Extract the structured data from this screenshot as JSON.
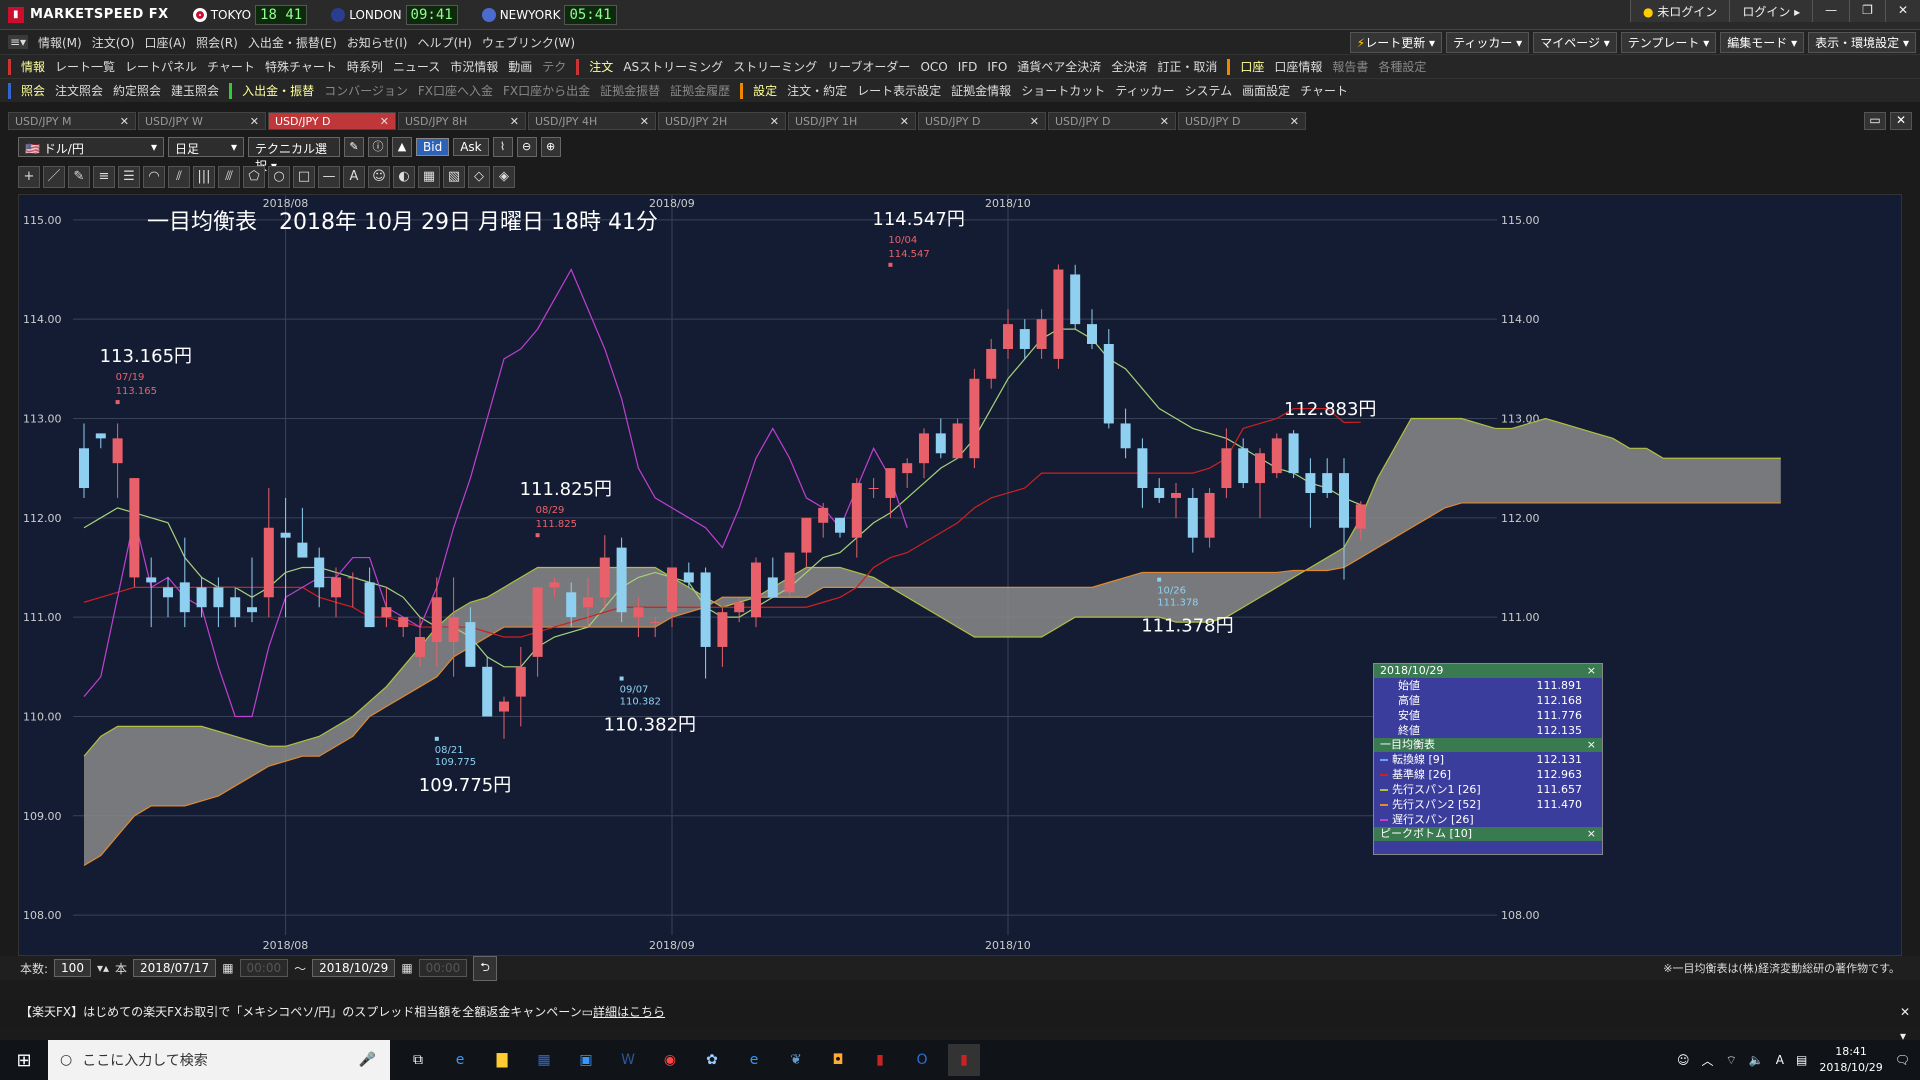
{
  "app": {
    "name": "MARKETSPEED FX"
  },
  "clocks": [
    {
      "label": "TOKYO",
      "time": "18 41",
      "color": "#c8102e"
    },
    {
      "label": "LONDON",
      "time": "09:41",
      "color": "#3a5bbf"
    },
    {
      "label": "NEWYORK",
      "time": "05:41",
      "color": "#4b6bcf"
    }
  ],
  "top_right": [
    "未ログイン",
    "ログイン"
  ],
  "menu": [
    "情報(M)",
    "注文(O)",
    "口座(A)",
    "照会(R)",
    "入出金・振替(E)",
    "お知らせ(I)",
    "ヘルプ(H)",
    "ウェブリンク(W)"
  ],
  "menu_right": [
    "レート更新",
    "ティッカー",
    "マイページ",
    "テンプレート",
    "編集モード",
    "表示・環境設定"
  ],
  "toolbar1": [
    "情報",
    "レート一覧",
    "レートパネル",
    "チャート",
    "特殊チャート",
    "時系列",
    "ニュース",
    "市況情報",
    "動画",
    "テク",
    "注文",
    "ASストリーミング",
    "ストリーミング",
    "リーブオーダー",
    "OCO",
    "IFD",
    "IFO",
    "通貨ペア全決済",
    "全決済",
    "訂正・取消",
    "口座",
    "口座情報",
    "報告書",
    "各種設定"
  ],
  "toolbar2": [
    "照会",
    "注文照会",
    "約定照会",
    "建玉照会",
    "入出金・振替",
    "コンバージョン",
    "FX口座へ入金",
    "FX口座から出金",
    "証拠金振替",
    "証拠金履歴",
    "設定",
    "注文・約定",
    "レート表示設定",
    "証拠金情報",
    "ショートカット",
    "ティッカー",
    "システム",
    "画面設定",
    "チャート"
  ],
  "tabs": [
    "USD/JPY M",
    "USD/JPY W",
    "USD/JPY D",
    "USD/JPY 8H",
    "USD/JPY 4H",
    "USD/JPY 2H",
    "USD/JPY 1H",
    "USD/JPY D",
    "USD/JPY D",
    "USD/JPY D"
  ],
  "active_tab": 2,
  "controls": {
    "pair": "ドル/円",
    "period": "日足",
    "tech": "テクニカル選択",
    "bid": "Bid",
    "ask": "Ask"
  },
  "draw_tools": [
    "+",
    "／",
    "✎",
    "≡",
    "☰",
    "◠",
    "⫽",
    "|||",
    "⫻",
    "⬠",
    "○",
    "□",
    "—",
    "A",
    "☺",
    "◐",
    "▦",
    "▧",
    "◇",
    "◈"
  ],
  "bottom": {
    "count_label": "本数:",
    "count": "100",
    "unit": "本",
    "from": "2018/07/17",
    "to": "2018/10/29",
    "time1": "00:00",
    "time2": "00:00",
    "note": "※一目均衡表は(株)経済変動総研の著作物です。"
  },
  "news": {
    "text": "【楽天FX】はじめての楽天FXお取引で「メキシコペソ/円」のスプレッド相当額を全額返金キャンペーン",
    "link": "詳細はこちら"
  },
  "taskbar": {
    "search": "ここに入力して検索",
    "time": "18:41",
    "date": "2018/10/29"
  },
  "info_panel": {
    "date": "2018/10/29",
    "ohlc": [
      [
        "始値",
        "111.891"
      ],
      [
        "高値",
        "112.168"
      ],
      [
        "安値",
        "111.776"
      ],
      [
        "終値",
        "112.135"
      ]
    ],
    "ichimoku_title": "一目均衡表",
    "lines": [
      [
        "転換線 [9]",
        "112.131",
        "#6fa0ff"
      ],
      [
        "基準線 [26]",
        "112.963",
        "#d02020"
      ],
      [
        "先行スパン1 [26]",
        "111.657",
        "#b0c040"
      ],
      [
        "先行スパン2 [52]",
        "111.470",
        "#e08a30"
      ],
      [
        "遅行スパン [26]",
        "",
        "#c040d0"
      ]
    ],
    "peak": "ピークボトム [10]"
  },
  "chart_data": {
    "type": "candlestick",
    "title": "一目均衡表　2018年 10月 29日 月曜日 18時 41分",
    "ylim": [
      107.8,
      115.25
    ],
    "yticks": [
      "108.00",
      "109.00",
      "110.00",
      "111.00",
      "112.00",
      "113.00",
      "114.00",
      "115.00"
    ],
    "xticks": [
      "2018/08",
      "2018/09",
      "2018/10"
    ],
    "annotations": [
      {
        "date": "07/19",
        "price": "113.165",
        "label": "113.165円",
        "type": "peak"
      },
      {
        "date": "08/21",
        "price": "109.775",
        "label": "109.775円",
        "type": "bottom"
      },
      {
        "date": "08/29",
        "price": "111.825",
        "label": "111.825円",
        "type": "peak"
      },
      {
        "date": "09/07",
        "price": "110.382",
        "label": "110.382円",
        "type": "bottom"
      },
      {
        "date": "10/04",
        "price": "114.547",
        "label": "114.547円",
        "type": "peak"
      },
      {
        "date": "10/26",
        "price": "111.378",
        "label": "111.378円",
        "type": "bottom"
      }
    ],
    "extra_label": "112.883円",
    "candles": [
      [
        112.7,
        112.95,
        112.2,
        112.3
      ],
      [
        112.85,
        112.85,
        112.7,
        112.8
      ],
      [
        112.55,
        112.95,
        112.2,
        112.8
      ],
      [
        111.4,
        112.4,
        111.3,
        112.4
      ],
      [
        111.4,
        111.6,
        110.9,
        111.35
      ],
      [
        111.3,
        111.4,
        111.0,
        111.2
      ],
      [
        111.35,
        111.8,
        110.9,
        111.05
      ],
      [
        111.3,
        111.4,
        111.0,
        111.1
      ],
      [
        111.3,
        111.4,
        110.9,
        111.1
      ],
      [
        111.2,
        111.3,
        110.9,
        111.0
      ],
      [
        111.1,
        111.6,
        110.95,
        111.05
      ],
      [
        111.2,
        112.3,
        111.0,
        111.9
      ],
      [
        111.85,
        112.2,
        111.0,
        111.8
      ],
      [
        111.75,
        112.1,
        111.6,
        111.6
      ],
      [
        111.6,
        111.7,
        111.1,
        111.3
      ],
      [
        111.2,
        111.5,
        111.0,
        111.4
      ],
      [
        111.4,
        111.45,
        111.1,
        111.4
      ],
      [
        111.35,
        111.5,
        110.9,
        110.9
      ],
      [
        111.0,
        111.3,
        110.9,
        111.1
      ],
      [
        110.9,
        111.0,
        110.8,
        111.0
      ],
      [
        110.6,
        111.0,
        110.5,
        110.8
      ],
      [
        110.75,
        111.4,
        110.5,
        111.2
      ],
      [
        110.75,
        111.4,
        110.4,
        111.0
      ],
      [
        110.95,
        111.1,
        110.5,
        110.5
      ],
      [
        110.5,
        110.6,
        110.0,
        110.0
      ],
      [
        110.05,
        110.2,
        109.775,
        110.15
      ],
      [
        110.2,
        110.7,
        109.9,
        110.5
      ],
      [
        110.6,
        111.3,
        110.4,
        111.3
      ],
      [
        111.3,
        111.4,
        111.2,
        111.35
      ],
      [
        111.25,
        111.35,
        110.9,
        111.0
      ],
      [
        111.1,
        111.4,
        110.9,
        111.2
      ],
      [
        111.2,
        111.825,
        111.1,
        111.6
      ],
      [
        111.7,
        111.8,
        110.95,
        111.05
      ],
      [
        111.0,
        111.2,
        110.8,
        111.1
      ],
      [
        110.95,
        111.0,
        110.8,
        110.95
      ],
      [
        111.05,
        111.5,
        110.9,
        111.5
      ],
      [
        111.45,
        111.55,
        111.3,
        111.35
      ],
      [
        111.45,
        111.5,
        110.382,
        110.7
      ],
      [
        110.7,
        111.1,
        110.5,
        111.05
      ],
      [
        111.05,
        111.2,
        110.95,
        111.15
      ],
      [
        111.0,
        111.6,
        110.9,
        111.55
      ],
      [
        111.4,
        111.6,
        111.2,
        111.2
      ],
      [
        111.25,
        111.65,
        111.2,
        111.65
      ],
      [
        111.65,
        112.0,
        111.5,
        112.0
      ],
      [
        111.95,
        112.15,
        111.8,
        112.1
      ],
      [
        112.0,
        112.0,
        111.8,
        111.85
      ],
      [
        111.8,
        112.4,
        111.6,
        112.35
      ],
      [
        112.3,
        112.4,
        112.2,
        112.3
      ],
      [
        112.2,
        112.5,
        112.0,
        112.5
      ],
      [
        112.45,
        112.6,
        112.3,
        112.55
      ],
      [
        112.55,
        112.9,
        112.4,
        112.85
      ],
      [
        112.85,
        113.0,
        112.6,
        112.65
      ],
      [
        112.6,
        113.0,
        112.6,
        112.95
      ],
      [
        112.6,
        113.5,
        112.5,
        113.4
      ],
      [
        113.4,
        113.8,
        113.3,
        113.7
      ],
      [
        113.7,
        114.1,
        113.6,
        113.95
      ],
      [
        113.9,
        114.0,
        113.6,
        113.7
      ],
      [
        113.7,
        114.1,
        113.6,
        114.0
      ],
      [
        113.6,
        114.55,
        113.5,
        114.5
      ],
      [
        114.45,
        114.547,
        113.9,
        113.95
      ],
      [
        113.95,
        114.1,
        113.7,
        113.75
      ],
      [
        113.75,
        113.9,
        112.9,
        112.95
      ],
      [
        112.95,
        113.1,
        112.6,
        112.7
      ],
      [
        112.7,
        112.8,
        112.1,
        112.3
      ],
      [
        112.3,
        112.4,
        112.15,
        112.2
      ],
      [
        112.2,
        112.35,
        112.0,
        112.25
      ],
      [
        112.2,
        112.3,
        111.65,
        111.8
      ],
      [
        111.8,
        112.3,
        111.7,
        112.25
      ],
      [
        112.3,
        112.9,
        112.2,
        112.7
      ],
      [
        112.7,
        112.8,
        112.3,
        112.35
      ],
      [
        112.35,
        112.7,
        112.0,
        112.65
      ],
      [
        112.45,
        112.85,
        112.4,
        112.8
      ],
      [
        112.85,
        112.883,
        112.4,
        112.45
      ],
      [
        112.45,
        112.6,
        111.9,
        112.25
      ],
      [
        112.45,
        112.6,
        112.2,
        112.25
      ],
      [
        112.45,
        112.6,
        111.378,
        111.9
      ],
      [
        111.891,
        112.168,
        111.776,
        112.135
      ]
    ],
    "tenkan": [
      111.9,
      112.0,
      112.1,
      112.05,
      112.0,
      111.95,
      111.6,
      111.4,
      111.3,
      111.3,
      111.2,
      111.3,
      111.45,
      111.5,
      111.5,
      111.45,
      111.4,
      111.35,
      111.3,
      111.2,
      111.0,
      110.9,
      110.9,
      110.8,
      110.6,
      110.5,
      110.5,
      110.7,
      110.8,
      110.85,
      110.9,
      111.1,
      111.3,
      111.4,
      111.45,
      111.4,
      111.35,
      111.1,
      111.0,
      111.0,
      111.1,
      111.2,
      111.3,
      111.45,
      111.6,
      111.65,
      111.8,
      111.95,
      112.05,
      112.2,
      112.35,
      112.5,
      112.6,
      112.8,
      113.1,
      113.4,
      113.6,
      113.8,
      113.9,
      113.9,
      113.8,
      113.6,
      113.5,
      113.3,
      113.1,
      113.0,
      112.9,
      112.85,
      112.8,
      112.7,
      112.6,
      112.5,
      112.45,
      112.35,
      112.3,
      112.2,
      112.131
    ],
    "kijun": [
      111.15,
      111.2,
      111.25,
      111.3,
      111.3,
      111.3,
      111.3,
      111.3,
      111.3,
      111.3,
      111.3,
      111.3,
      111.3,
      111.3,
      111.2,
      111.15,
      111.1,
      111.0,
      111.0,
      110.95,
      110.9,
      110.9,
      110.9,
      110.9,
      110.85,
      110.8,
      110.8,
      110.85,
      110.9,
      110.95,
      111.0,
      111.05,
      111.1,
      111.1,
      111.1,
      111.1,
      111.1,
      111.1,
      111.1,
      111.1,
      111.1,
      111.1,
      111.1,
      111.1,
      111.15,
      111.2,
      111.3,
      111.5,
      111.6,
      111.65,
      111.75,
      111.85,
      111.95,
      112.1,
      112.2,
      112.25,
      112.3,
      112.45,
      112.45,
      112.45,
      112.45,
      112.45,
      112.45,
      112.45,
      112.45,
      112.45,
      112.45,
      112.5,
      112.6,
      112.9,
      112.95,
      113.0,
      113.1,
      113.1,
      113.1,
      112.96,
      112.963
    ],
    "chikou": [
      110.2,
      110.4,
      111.2,
      112.0,
      111.3,
      111.4,
      111.2,
      111.1,
      110.5,
      110.0,
      110.0,
      110.7,
      111.2,
      111.3,
      111.4,
      111.4,
      111.6,
      111.6,
      111.1,
      111.0,
      110.9,
      111.3,
      111.9,
      112.4,
      113.0,
      113.6,
      113.7,
      113.9,
      114.2,
      114.5,
      114.1,
      113.7,
      113.2,
      112.5,
      112.2,
      112.1,
      112.0,
      111.9,
      111.7,
      112.1,
      112.6,
      112.9,
      112.6,
      112.2,
      112.1,
      111.9,
      112.3,
      112.7,
      112.4,
      111.9
    ],
    "span_a": [
      109.6,
      109.8,
      109.9,
      109.9,
      109.9,
      109.9,
      109.9,
      109.9,
      109.85,
      109.8,
      109.75,
      109.7,
      109.7,
      109.75,
      109.8,
      109.9,
      110.0,
      110.15,
      110.3,
      110.5,
      110.7,
      110.9,
      111.05,
      111.15,
      111.2,
      111.3,
      111.4,
      111.5,
      111.5,
      111.5,
      111.5,
      111.5,
      111.5,
      111.5,
      111.5,
      111.4,
      111.3,
      111.2,
      111.1,
      111.15,
      111.2,
      111.3,
      111.4,
      111.5,
      111.5,
      111.5,
      111.45,
      111.4,
      111.3,
      111.2,
      111.1,
      111.0,
      110.9,
      110.8,
      110.8,
      110.8,
      110.8,
      110.8,
      110.9,
      111.0,
      111.0,
      111.0,
      111.0,
      111.0,
      111.0,
      110.95,
      110.95,
      110.95,
      111.0,
      111.1,
      111.2,
      111.3,
      111.4,
      111.5,
      111.6,
      111.7,
      112.0,
      112.4,
      112.7,
      113.0,
      113.0,
      113.0,
      113.0,
      112.95,
      112.9,
      112.9,
      112.95,
      113.0,
      112.95,
      112.9,
      112.85,
      112.8,
      112.7,
      112.7,
      112.6,
      112.6,
      112.6,
      112.6,
      112.6,
      112.6,
      112.6,
      112.6
    ],
    "span_b": [
      108.5,
      108.6,
      108.8,
      109.0,
      109.1,
      109.1,
      109.1,
      109.15,
      109.2,
      109.3,
      109.4,
      109.5,
      109.55,
      109.6,
      109.6,
      109.7,
      109.8,
      110.0,
      110.1,
      110.2,
      110.3,
      110.4,
      110.6,
      110.7,
      110.8,
      110.9,
      110.9,
      110.9,
      110.9,
      110.9,
      110.9,
      110.9,
      110.9,
      110.9,
      110.9,
      111.0,
      111.05,
      111.1,
      111.2,
      111.2,
      111.2,
      111.2,
      111.2,
      111.2,
      111.3,
      111.3,
      111.3,
      111.3,
      111.3,
      111.3,
      111.3,
      111.3,
      111.3,
      111.3,
      111.3,
      111.3,
      111.3,
      111.3,
      111.3,
      111.3,
      111.3,
      111.35,
      111.4,
      111.45,
      111.45,
      111.45,
      111.45,
      111.45,
      111.45,
      111.45,
      111.45,
      111.45,
      111.47,
      111.47,
      111.47,
      111.5,
      111.6,
      111.7,
      111.8,
      111.9,
      112.0,
      112.1,
      112.15,
      112.15,
      112.15,
      112.15,
      112.15,
      112.15,
      112.15,
      112.15,
      112.15,
      112.15,
      112.15,
      112.15,
      112.15,
      112.15,
      112.15,
      112.15,
      112.15,
      112.15,
      112.15,
      112.15
    ]
  }
}
